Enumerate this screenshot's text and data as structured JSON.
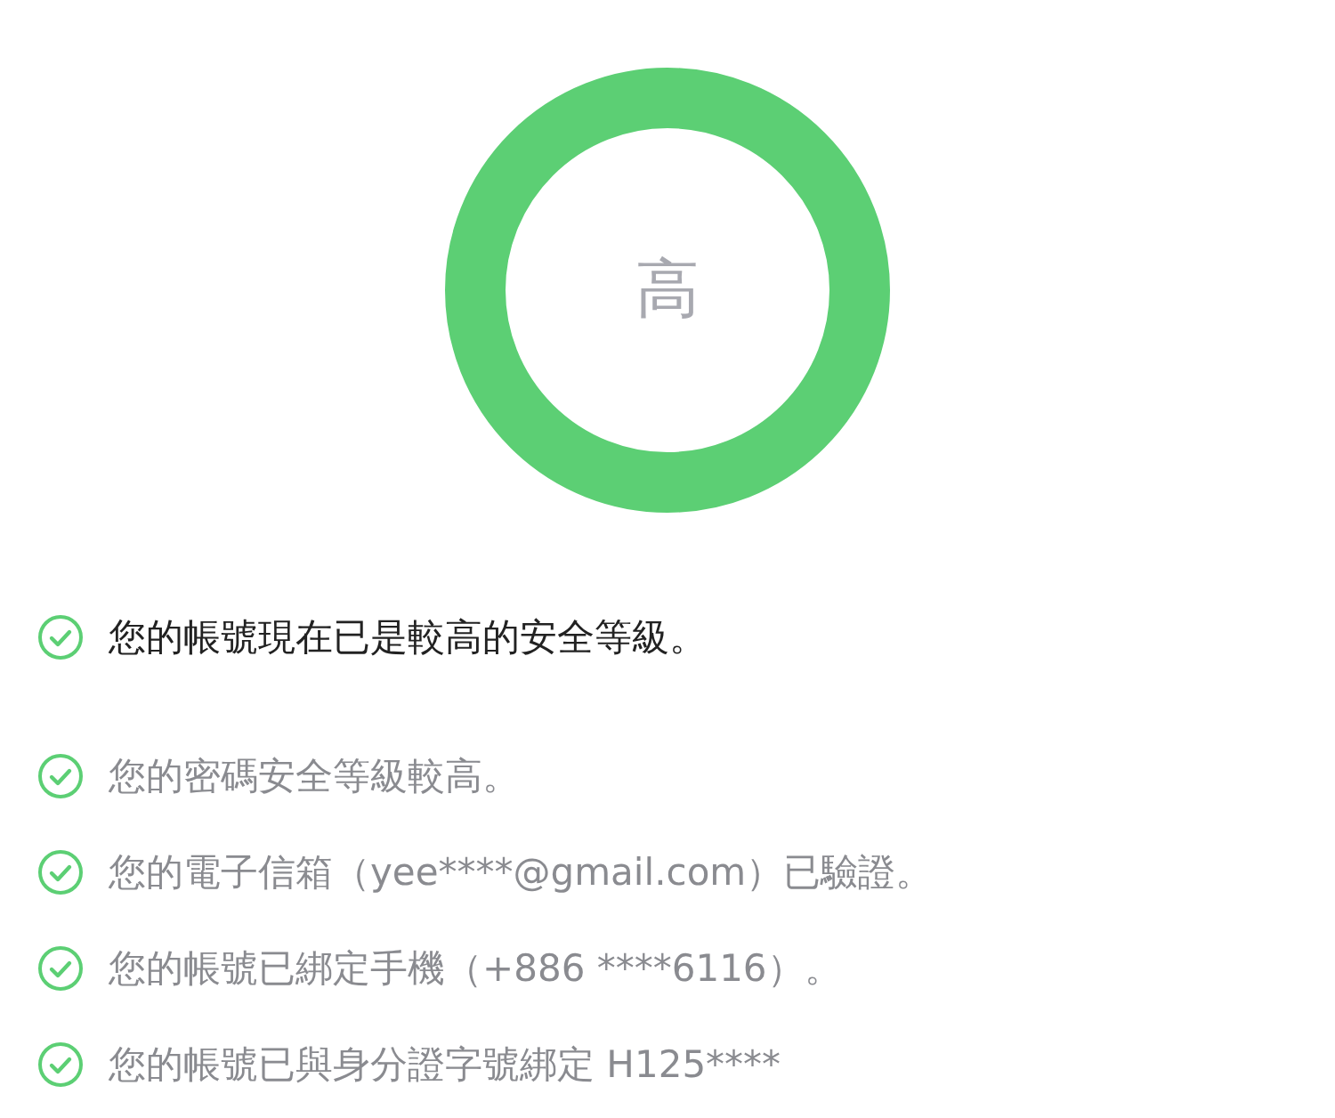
{
  "security_ring": {
    "label": "高"
  },
  "summary": {
    "text": "您的帳號現在已是較高的安全等級。",
    "checked": true
  },
  "items": [
    {
      "text": "您的密碼安全等級較高。",
      "checked": true
    },
    {
      "text": "您的電子信箱（yee****@gmail.com）已驗證。",
      "checked": true
    },
    {
      "text": "您的帳號已綁定手機（+886 ****6116）。",
      "checked": true
    },
    {
      "text": "您的帳號已與身分證字號綁定 H125****",
      "checked": true
    }
  ]
}
